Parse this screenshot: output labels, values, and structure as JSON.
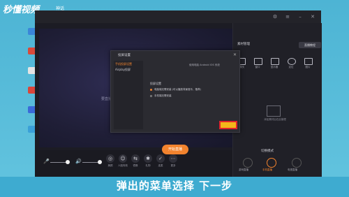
{
  "watermark": {
    "logo": "秒懂视频",
    "sub": "神话"
  },
  "window_title": "",
  "preview": {
    "note": "要直播什么"
  },
  "toolbar": {
    "tools": [
      {
        "icon": "beauty-icon",
        "label": "美颜"
      },
      {
        "icon": "filter-icon",
        "label": "人脸特效"
      },
      {
        "icon": "mirror-icon",
        "label": "镜像"
      },
      {
        "icon": "gift-icon",
        "label": "礼物"
      },
      {
        "icon": "pk-icon",
        "label": "连麦"
      },
      {
        "icon": "more-icon",
        "label": "更多"
      }
    ],
    "go_live": "开始直播"
  },
  "side": {
    "tab": "素材管理",
    "help_button": "直播教程",
    "sources": [
      {
        "icon": "camera-icon",
        "label": "摄像头"
      },
      {
        "icon": "window-icon",
        "label": "窗口"
      },
      {
        "icon": "screen-icon",
        "label": "显示器"
      },
      {
        "icon": "location-icon",
        "label": "定位"
      },
      {
        "icon": "image-icon",
        "label": "图片"
      }
    ],
    "empty_hint": "添加素材后在此管理",
    "mode_title": "切换模式",
    "modes": [
      {
        "label": "游戏直播"
      },
      {
        "label": "手机直播"
      },
      {
        "label": "电视直播"
      }
    ]
  },
  "dialog": {
    "title": "投屏设置",
    "menu": [
      "手机投屏设置",
      "Airplay投屏"
    ],
    "header_right": "使用电脑 Android IOS 系统",
    "section": "投屏设置",
    "options": [
      "电脑端无需安装 (可以播放背景音乐、推荐)",
      "手机端无需安装"
    ]
  },
  "caption": "弹出的菜单选择 下一步",
  "colors": {
    "accent": "#f2832e",
    "highlight": "#f3b61a",
    "marker": "#e0232b"
  }
}
